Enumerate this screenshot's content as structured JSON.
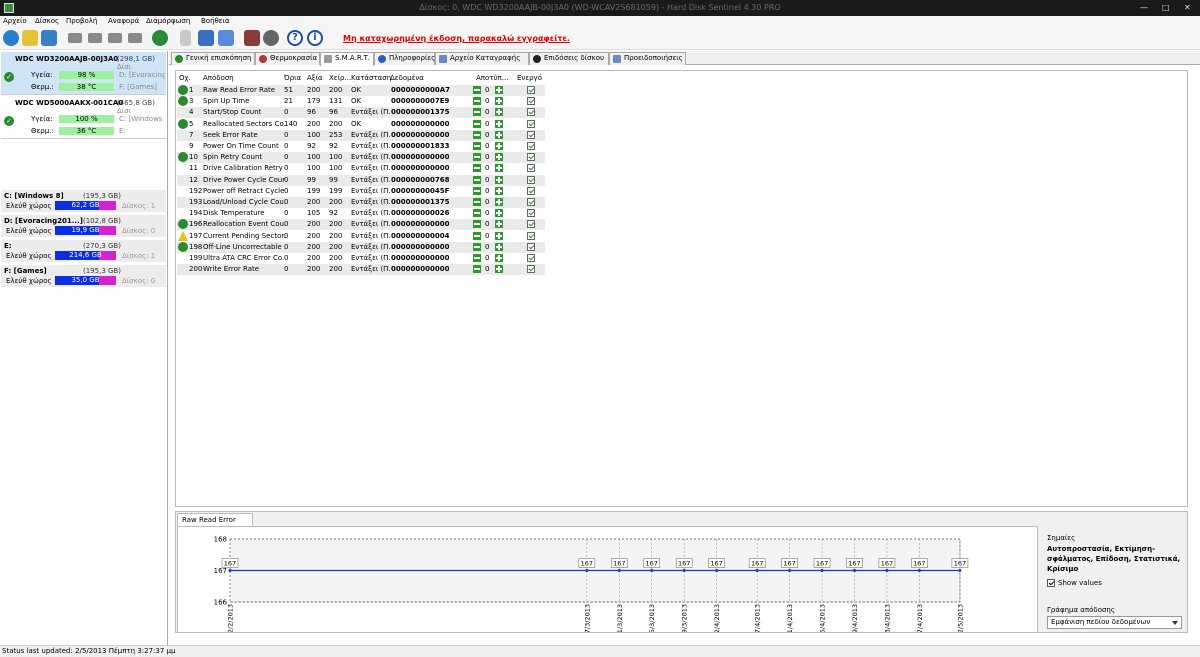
{
  "window": {
    "title": "Δίσκος: 0, WDC WD3200AAJB-00J3A0 (WD-WCAV2S681059) - Hard Disk Sentinel 4.30 PRO",
    "controls": [
      "—",
      "□",
      "✕"
    ]
  },
  "menu": [
    "Αρχείο",
    "Δίσκος",
    "Προβολή",
    "Αναφορά",
    "Διαμόρφωση",
    "Βοήθεια"
  ],
  "registration_notice": "Μη καταχωρημένη έκδοση, παρακαλώ εγγραφείτε.",
  "disks": [
    {
      "name": "WDC WD3200AAJB-00J3A0",
      "size": "(298,1 GB)",
      "trail": "Δίσι",
      "health_label": "Υγεία:",
      "health": "98 %",
      "health_pct": 98,
      "temp_label": "Θερμ.:",
      "temp": "38 °C",
      "vol1": "D: [Evoracing",
      "vol2": "F: [Games]"
    },
    {
      "name": "WDC WD5000AAKX-001CA0",
      "size": "(465,8 GB)",
      "trail": "Δίσι",
      "health_label": "Υγεία:",
      "health": "100 %",
      "health_pct": 100,
      "temp_label": "Θερμ.:",
      "temp": "36 °C",
      "vol1": "C: [Windows 8",
      "vol2": "E:"
    }
  ],
  "partitions": [
    {
      "name": "C: [Windows 8]",
      "size": "(195,3 GB)",
      "free_label": "Ελεύθ χώρος",
      "free": "62,2 GB",
      "disk": "Δίσκος: 1"
    },
    {
      "name": "D: [Evoracing201...]",
      "size": "(102,8 GB)",
      "free_label": "Ελεύθ χώρος",
      "free": "19,9 GB",
      "disk": "Δίσκος: 0"
    },
    {
      "name": "E:",
      "size": "(270,3 GB)",
      "free_label": "Ελεύθ χώρος",
      "free": "214,6 GB",
      "disk": "Δίσκος: 1"
    },
    {
      "name": "F: [Games]",
      "size": "(195,3 GB)",
      "free_label": "Ελεύθ χώρος",
      "free": "35,0 GB",
      "disk": "Δίσκος: 0"
    }
  ],
  "tabs": [
    "Γενική επισκόπηση",
    "Θερμοκρασία",
    "S.M.A.R.T.",
    "Πληροφορίες",
    "Αρχείο Καταγραφής",
    "Επιδόσεις δίσκου",
    "Προειδοποιήσεις"
  ],
  "table": {
    "headers": [
      "Οχ.",
      "Απόδοση",
      "Όρια",
      "Αξία",
      "Χείρ...",
      "Κατάσταση",
      "Δεδομένα",
      "Αποτύπ...",
      "Ενεργό"
    ],
    "rows": [
      {
        "id": "1",
        "name": "Raw Read Error Rate",
        "thr": "51",
        "val": "200",
        "worst": "200",
        "status": "OK",
        "data": "0000000000A7",
        "offset": "0",
        "icon": "ok"
      },
      {
        "id": "3",
        "name": "Spin Up Time",
        "thr": "21",
        "val": "179",
        "worst": "131",
        "status": "OK",
        "data": "0000000007E9",
        "offset": "0",
        "icon": "ok"
      },
      {
        "id": "4",
        "name": "Start/Stop Count",
        "thr": "0",
        "val": "96",
        "worst": "96",
        "status": "Εντάξει (Π...",
        "data": "000000001375",
        "offset": "0",
        "icon": ""
      },
      {
        "id": "5",
        "name": "Reallocated Sectors Co...",
        "thr": "140",
        "val": "200",
        "worst": "200",
        "status": "OK",
        "data": "000000000000",
        "offset": "0",
        "icon": "ok"
      },
      {
        "id": "7",
        "name": "Seek Error Rate",
        "thr": "0",
        "val": "100",
        "worst": "253",
        "status": "Εντάξει (Π...",
        "data": "000000000000",
        "offset": "0",
        "icon": ""
      },
      {
        "id": "9",
        "name": "Power On Time Count",
        "thr": "0",
        "val": "92",
        "worst": "92",
        "status": "Εντάξει (Π...",
        "data": "000000001833",
        "offset": "0",
        "icon": ""
      },
      {
        "id": "10",
        "name": "Spin Retry Count",
        "thr": "0",
        "val": "100",
        "worst": "100",
        "status": "Εντάξει (Π...",
        "data": "000000000000",
        "offset": "0",
        "icon": "ok"
      },
      {
        "id": "11",
        "name": "Drive Calibration Retry ...",
        "thr": "0",
        "val": "100",
        "worst": "100",
        "status": "Εντάξει (Π...",
        "data": "000000000000",
        "offset": "0",
        "icon": ""
      },
      {
        "id": "12",
        "name": "Drive Power Cycle Count",
        "thr": "0",
        "val": "99",
        "worst": "99",
        "status": "Εντάξει (Π...",
        "data": "000000000768",
        "offset": "0",
        "icon": ""
      },
      {
        "id": "192",
        "name": "Power off Retract Cycle ...",
        "thr": "0",
        "val": "199",
        "worst": "199",
        "status": "Εντάξει (Π...",
        "data": "00000000045F",
        "offset": "0",
        "icon": ""
      },
      {
        "id": "193",
        "name": "Load/Unload Cycle Cou...",
        "thr": "0",
        "val": "200",
        "worst": "200",
        "status": "Εντάξει (Π...",
        "data": "000000001375",
        "offset": "0",
        "icon": ""
      },
      {
        "id": "194",
        "name": "Disk Temperature",
        "thr": "0",
        "val": "105",
        "worst": "92",
        "status": "Εντάξει (Π...",
        "data": "000000000026",
        "offset": "0",
        "icon": ""
      },
      {
        "id": "196",
        "name": "Reallocation Event Count",
        "thr": "0",
        "val": "200",
        "worst": "200",
        "status": "Εντάξει (Π...",
        "data": "000000000000",
        "offset": "0",
        "icon": "ok"
      },
      {
        "id": "197",
        "name": "Current Pending Sector...",
        "thr": "0",
        "val": "200",
        "worst": "200",
        "status": "Εντάξει (Π...",
        "data": "000000000004",
        "offset": "0",
        "icon": "warn"
      },
      {
        "id": "198",
        "name": "Off-Line Uncorrectable ...",
        "thr": "0",
        "val": "200",
        "worst": "200",
        "status": "Εντάξει (Π...",
        "data": "000000000000",
        "offset": "0",
        "icon": "ok"
      },
      {
        "id": "199",
        "name": "Ultra ATA CRC Error Co...",
        "thr": "0",
        "val": "200",
        "worst": "200",
        "status": "Εντάξει (Π...",
        "data": "000000000000",
        "offset": "0",
        "icon": ""
      },
      {
        "id": "200",
        "name": "Write Error Rate",
        "thr": "0",
        "val": "200",
        "worst": "200",
        "status": "Εντάξει (Π...",
        "data": "000000000000",
        "offset": "0",
        "icon": ""
      }
    ]
  },
  "chart_tab": "Raw Read Error Rate",
  "chart_data": {
    "type": "line",
    "ylim": [
      166,
      168
    ],
    "yticks": [
      "168",
      "167",
      "166"
    ],
    "x": [
      "12/2/2013",
      "17/3/2013",
      "21/3/2013",
      "25/3/2013",
      "29/3/2013",
      "2/4/2013",
      "7/4/2013",
      "11/4/2013",
      "15/4/2013",
      "19/4/2013",
      "23/4/2013",
      "27/4/2013",
      "2/5/2013"
    ],
    "x_pos": [
      0,
      44,
      48,
      52,
      56,
      60,
      65,
      69,
      73,
      77,
      81,
      85,
      90
    ],
    "series": [
      {
        "values": [
          167,
          167,
          167,
          167,
          167,
          167,
          167,
          167,
          167,
          167,
          167,
          167,
          167
        ]
      }
    ],
    "point_labels": [
      "167",
      "167",
      "167",
      "167",
      "167",
      "167",
      "167",
      "167",
      "167",
      "167",
      "167",
      "167",
      "167"
    ]
  },
  "side": {
    "notes_label": "Σημαίες",
    "notes_value": "Αυτοπροστασία, Εκτίμηση-σφάλματος, Επίδοση, Στατιστικά, Κρίσιμο",
    "show_values": "Show values",
    "graph_label": "Γράφημα απόδοσης",
    "graph_select": "Εμφάνιση πεδίου δεδομένων"
  },
  "status": "Status last updated: 2/5/2013 Πέμπτη 3:27:37 μμ"
}
